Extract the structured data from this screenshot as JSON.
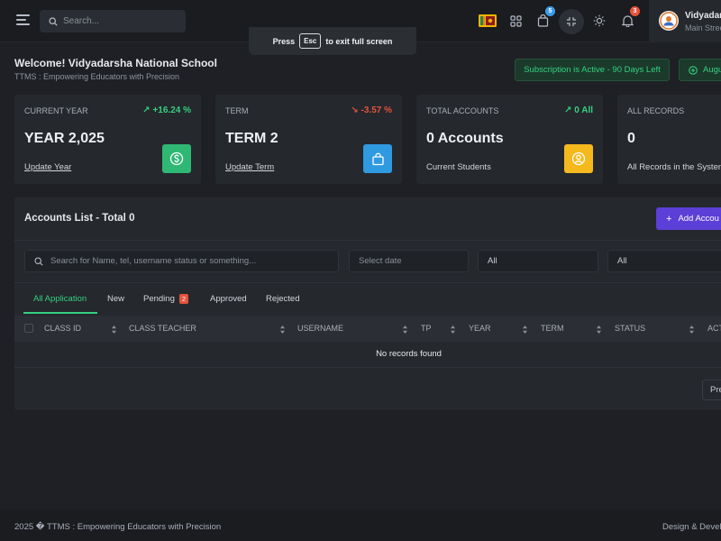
{
  "header": {
    "search_placeholder": "Search...",
    "cart_badge": "5",
    "notif_badge": "3",
    "user_name": "Vidyadars",
    "user_sub": "Main Stree"
  },
  "toast": {
    "press": "Press",
    "key": "Esc",
    "rest": "to exit full screen"
  },
  "welcome": {
    "title": "Welcome! Vidyadarsha National School",
    "tagline": "TTMS : Empowering Educators with Precision",
    "subscription": "Subscription is Active - 90 Days Left",
    "month_btn": "Augu"
  },
  "cards": [
    {
      "title": "CURRENT YEAR",
      "delta": "↗ +16.24 %",
      "value": "YEAR 2,025",
      "link": "Update Year",
      "icon": "dollar-icon",
      "color": "#2fb874"
    },
    {
      "title": "TERM",
      "delta": "↘ -3.57 %",
      "value": "TERM 2",
      "link": "Update Term",
      "icon": "bag-icon",
      "color": "#2f9ae0"
    },
    {
      "title": "TOTAL ACCOUNTS",
      "delta": "↗ 0 All",
      "value": "0 Accounts",
      "link": "Current Students",
      "icon": "user-icon",
      "color": "#f5b91d"
    },
    {
      "title": "ALL RECORDS",
      "delta": "",
      "value": "0",
      "link": "All Records in the System"
    }
  ],
  "accounts": {
    "title": "Accounts List - Total 0",
    "add_btn": "Add Accou",
    "search_placeholder": "Search for Name, tel, username status or something...",
    "date_placeholder": "Select date",
    "filter1": "All",
    "filter2": "All",
    "tabs": [
      {
        "label": "All Application"
      },
      {
        "label": "New"
      },
      {
        "label": "Pending",
        "badge": "2"
      },
      {
        "label": "Approved"
      },
      {
        "label": "Rejected"
      }
    ],
    "columns": [
      "CLASS ID",
      "CLASS TEACHER",
      "USERNAME",
      "TP",
      "YEAR",
      "TERM",
      "STATUS",
      "ACT"
    ],
    "empty": "No records found",
    "prev": "Pre"
  },
  "footer": {
    "left": "2025 � TTMS : Empowering Educators with Precision",
    "right": "Design & Develo"
  }
}
